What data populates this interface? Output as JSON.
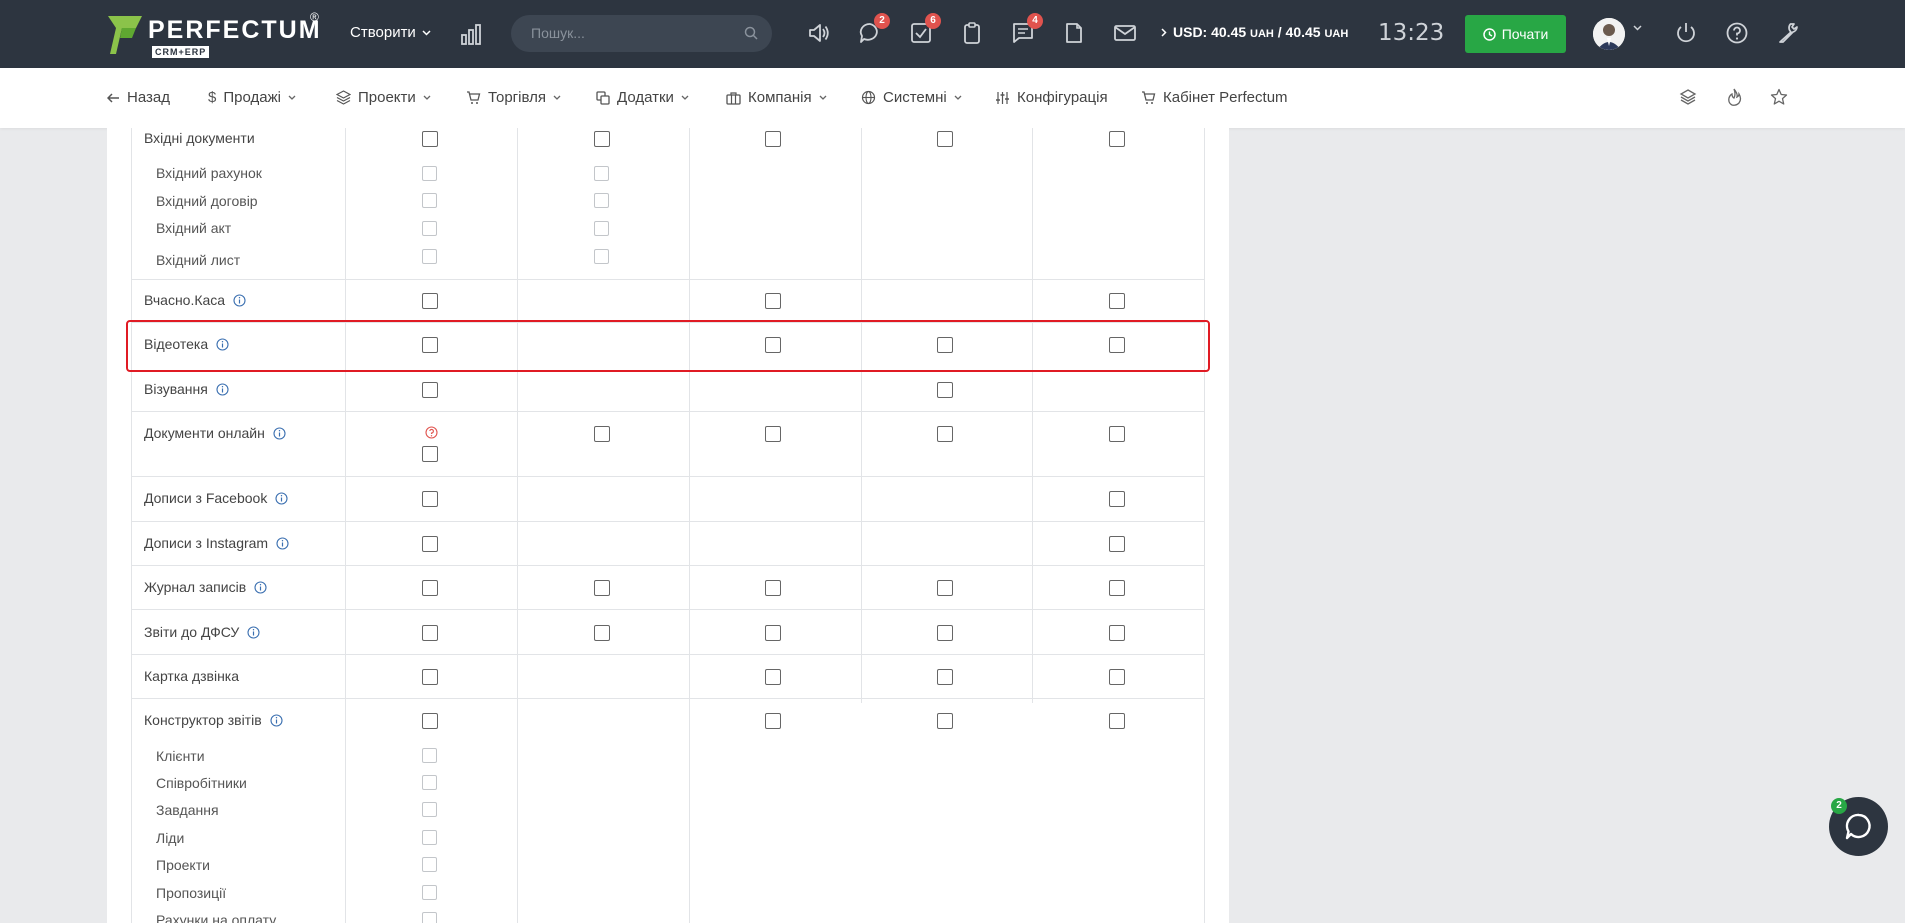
{
  "header": {
    "logo_text": "PERFECTUM",
    "logo_sub": "CRM+ERP",
    "logo_reg": "®",
    "create_label": "Створити",
    "search_placeholder": "Пошук...",
    "badges": {
      "chat": "2",
      "tasks": "6",
      "messages": "4"
    },
    "usd_prefix": "USD: 40.45",
    "usd_unit1": "UAH",
    "usd_mid": " / 40.45",
    "usd_unit2": "UAH",
    "clock": "13:23",
    "start_label": "Почати"
  },
  "nav": {
    "back": "Назад",
    "sales": "Продажі",
    "projects": "Проекти",
    "trade": "Торгівля",
    "addons": "Додатки",
    "company": "Компанія",
    "system": "Системні",
    "config": "Конфігурація",
    "cabinet": "Кабінет Perfectum"
  },
  "rows": {
    "incoming_docs": "Вхідні документи",
    "incoming_invoice": "Вхідний рахунок",
    "incoming_contract": "Вхідний договір",
    "incoming_act": "Вхідний акт",
    "incoming_letter": "Вхідний лист",
    "vchasno": "Вчасно.Каса",
    "videoteka": "Відеотека",
    "vizuvannia": "Візування",
    "docs_online": "Документи онлайн",
    "fb_posts": "Дописи з Facebook",
    "ig_posts": "Дописи з Instagram",
    "journal": "Журнал записів",
    "dfsu": "Звіти до ДФСУ",
    "call_card": "Картка дзвінка",
    "report_builder": "Конструктор звітів",
    "rb_clients": "Клієнти",
    "rb_staff": "Співробітники",
    "rb_tasks": "Завдання",
    "rb_leads": "Ліди",
    "rb_projects": "Проекти",
    "rb_proposals": "Пропозиції",
    "rb_invoices": "Рахунки на оплату"
  },
  "chat_badge": "2",
  "colors": {
    "header_bg": "#2d3540",
    "accent_green": "#28a745",
    "badge_red": "#e0534e",
    "highlight_red": "#e01b24"
  }
}
